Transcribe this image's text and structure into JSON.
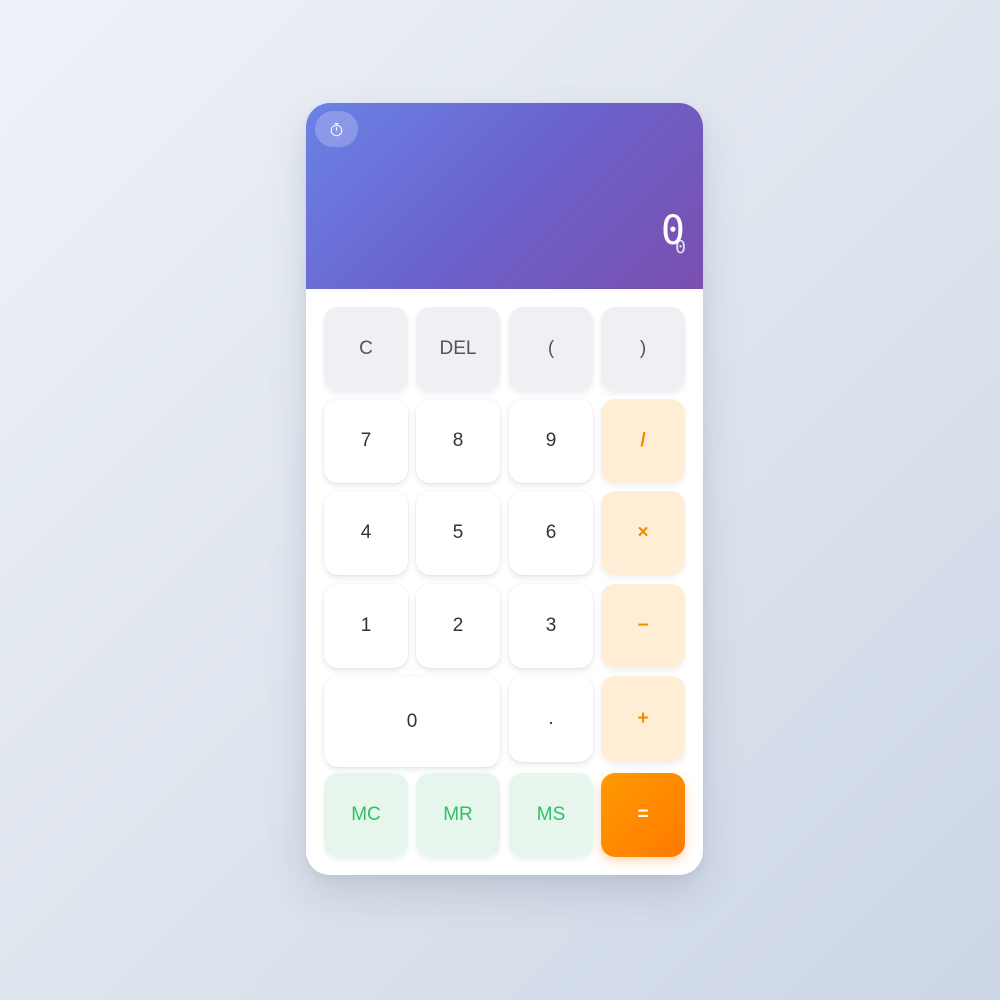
{
  "display": {
    "history_icon": "stopwatch-icon",
    "expression": "0",
    "result": "0"
  },
  "keys": {
    "clear": "C",
    "delete": "DEL",
    "paren_open": "(",
    "paren_close": ")",
    "seven": "7",
    "eight": "8",
    "nine": "9",
    "divide": "/",
    "four": "4",
    "five": "5",
    "six": "6",
    "multiply": "×",
    "one": "1",
    "two": "2",
    "three": "3",
    "subtract": "−",
    "zero": "0",
    "decimal": ".",
    "add": "+",
    "memory_clear": "MC",
    "memory_recall": "MR",
    "memory_store": "MS",
    "equals": "="
  },
  "colors": {
    "display_gradient_start": "#6a82e6",
    "display_gradient_end": "#7a4fae",
    "operator_text": "#f08c00",
    "operator_bg": "#ffeed5",
    "memory_text": "#2fbf66",
    "memory_bg": "#e7f6ec",
    "equals_bg": "#ff8a00"
  }
}
